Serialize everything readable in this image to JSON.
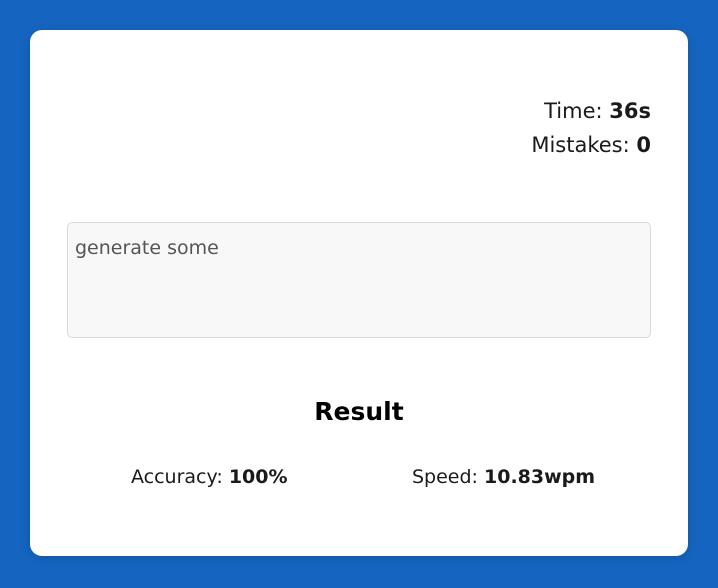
{
  "stats": {
    "time_label": "Time: ",
    "time_value": "36s",
    "mistakes_label": "Mistakes: ",
    "mistakes_value": "0"
  },
  "input": {
    "value": "generate some"
  },
  "result": {
    "title": "Result",
    "accuracy_label": "Accuracy: ",
    "accuracy_value": "100%",
    "speed_label": "Speed: ",
    "speed_value": "10.83wpm"
  },
  "colors": {
    "background": "#1565c0",
    "card": "#ffffff",
    "input_bg": "#f8f8f8"
  }
}
